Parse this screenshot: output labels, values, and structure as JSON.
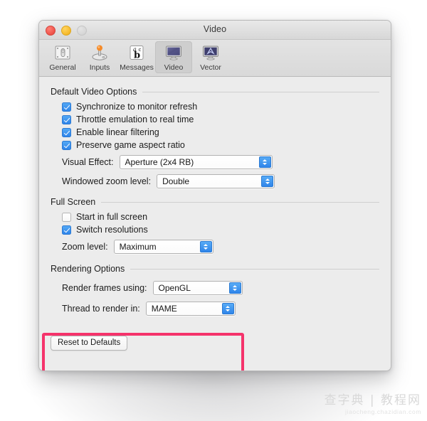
{
  "window": {
    "title": "Video",
    "traffic_lights": [
      {
        "name": "close",
        "color": "#f0554c",
        "enabled": true
      },
      {
        "name": "minimize",
        "color": "#f6bb2e",
        "enabled": true
      },
      {
        "name": "zoom",
        "color": "#d7d7d7",
        "enabled": false
      }
    ]
  },
  "toolbar": {
    "items": [
      {
        "label": "General",
        "icon": "switch-icon",
        "selected": false
      },
      {
        "label": "Inputs",
        "icon": "joystick-icon",
        "selected": false
      },
      {
        "label": "Messages",
        "icon": "abc-icon",
        "selected": false
      },
      {
        "label": "Video",
        "icon": "monitor-icon",
        "selected": true
      },
      {
        "label": "Vector",
        "icon": "vector-monitor-icon",
        "selected": false
      }
    ]
  },
  "sections": {
    "default_video": {
      "heading": "Default Video Options",
      "checkboxes": [
        {
          "label": "Synchronize to monitor refresh",
          "checked": true
        },
        {
          "label": "Throttle emulation to real time",
          "checked": true
        },
        {
          "label": "Enable linear filtering",
          "checked": true
        },
        {
          "label": "Preserve game aspect ratio",
          "checked": true
        }
      ],
      "popups": [
        {
          "label": "Visual Effect:",
          "value": "Aperture (2x4 RB)"
        },
        {
          "label": "Windowed zoom level:",
          "value": "Double"
        }
      ]
    },
    "full_screen": {
      "heading": "Full Screen",
      "checkboxes": [
        {
          "label": "Start in full screen",
          "checked": false
        },
        {
          "label": "Switch resolutions",
          "checked": true
        }
      ],
      "popups": [
        {
          "label": "Zoom level:",
          "value": "Maximum"
        }
      ]
    },
    "rendering": {
      "heading": "Rendering Options",
      "popups": [
        {
          "label": "Render frames using:",
          "value": "OpenGL"
        },
        {
          "label": "Thread to render in:",
          "value": "MAME"
        }
      ],
      "highlight_color": "#f5336b"
    }
  },
  "reset_button": {
    "label": "Reset to Defaults"
  },
  "watermark": {
    "main": "查字典 | 教程网",
    "sub": "jiaocheng.chazidian.com"
  }
}
